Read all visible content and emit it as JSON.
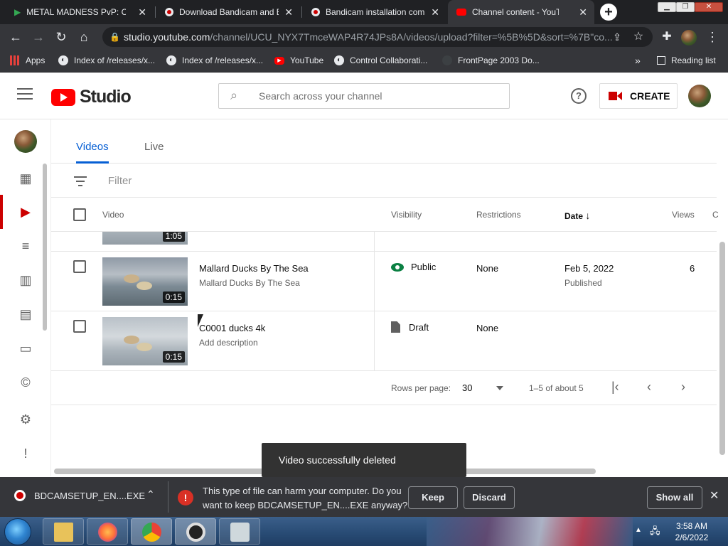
{
  "browser": {
    "tabs": [
      {
        "title": "METAL MADNESS PvP: Car",
        "icon": "play-store-icon",
        "active": false
      },
      {
        "title": "Download Bandicam and B",
        "icon": "bandicam-icon",
        "active": false
      },
      {
        "title": "Bandicam installation comp",
        "icon": "bandicam-icon",
        "active": false
      },
      {
        "title": "Channel content - YouTube",
        "icon": "youtube-icon",
        "active": true
      }
    ],
    "url_host": "studio.youtube.com",
    "url_path": "/channel/UCU_NYX7TmceWAP4R74JPs8A/videos/upload?filter=%5B%5D&sort=%7B\"co...",
    "bookmarks": [
      {
        "label": "Apps",
        "icon": "apps-grid-icon"
      },
      {
        "label": "Index of /releases/x...",
        "icon": "globe-icon"
      },
      {
        "label": "Index of /releases/x...",
        "icon": "globe-icon"
      },
      {
        "label": "YouTube",
        "icon": "youtube-icon"
      },
      {
        "label": "Control Collaborati...",
        "icon": "globe-icon"
      },
      {
        "label": "FrontPage 2003 Do...",
        "icon": "blank-page-icon"
      }
    ],
    "reading_list": "Reading list"
  },
  "studio": {
    "logo_text": "Studio",
    "search_placeholder": "Search across your channel",
    "create_label": "CREATE",
    "brand_color": "#ff0000"
  },
  "content": {
    "tabs": [
      {
        "label": "Videos",
        "active": true
      },
      {
        "label": "Live",
        "active": false
      }
    ],
    "filter_placeholder": "Filter",
    "columns": {
      "video": "Video",
      "visibility": "Visibility",
      "restrictions": "Restrictions",
      "date": "Date",
      "views": "Views",
      "comments": "C"
    },
    "partial_row": {
      "duration": "1:05"
    },
    "rows": [
      {
        "title": "Mallard Ducks By The Sea",
        "description": "Mallard Ducks By The Sea",
        "duration": "0:15",
        "visibility": "Public",
        "restrictions": "None",
        "date": "Feb 5, 2022",
        "date_status": "Published",
        "views": "6"
      },
      {
        "title": "C0001 ducks 4k",
        "description": "Add description",
        "duration": "0:15",
        "visibility": "Draft",
        "restrictions": "None",
        "date": "",
        "date_status": "",
        "views": ""
      }
    ],
    "pagination": {
      "rows_per_page_label": "Rows per page:",
      "rows_per_page": "30",
      "range": "1–5 of about 5"
    },
    "snackbar": "Video successfully deleted"
  },
  "downloads": {
    "file": "BDCAMSETUP_EN....EXE",
    "warning": "This type of file can harm your computer. Do you want to keep BDCAMSETUP_EN....EXE anyway?",
    "keep": "Keep",
    "discard": "Discard",
    "show_all": "Show all"
  },
  "taskbar": {
    "time": "3:58 AM",
    "date": "2/6/2022",
    "apps": [
      "file-explorer-icon",
      "firefox-icon",
      "chrome-icon",
      "bandicam-icon",
      "network-app-icon"
    ]
  }
}
